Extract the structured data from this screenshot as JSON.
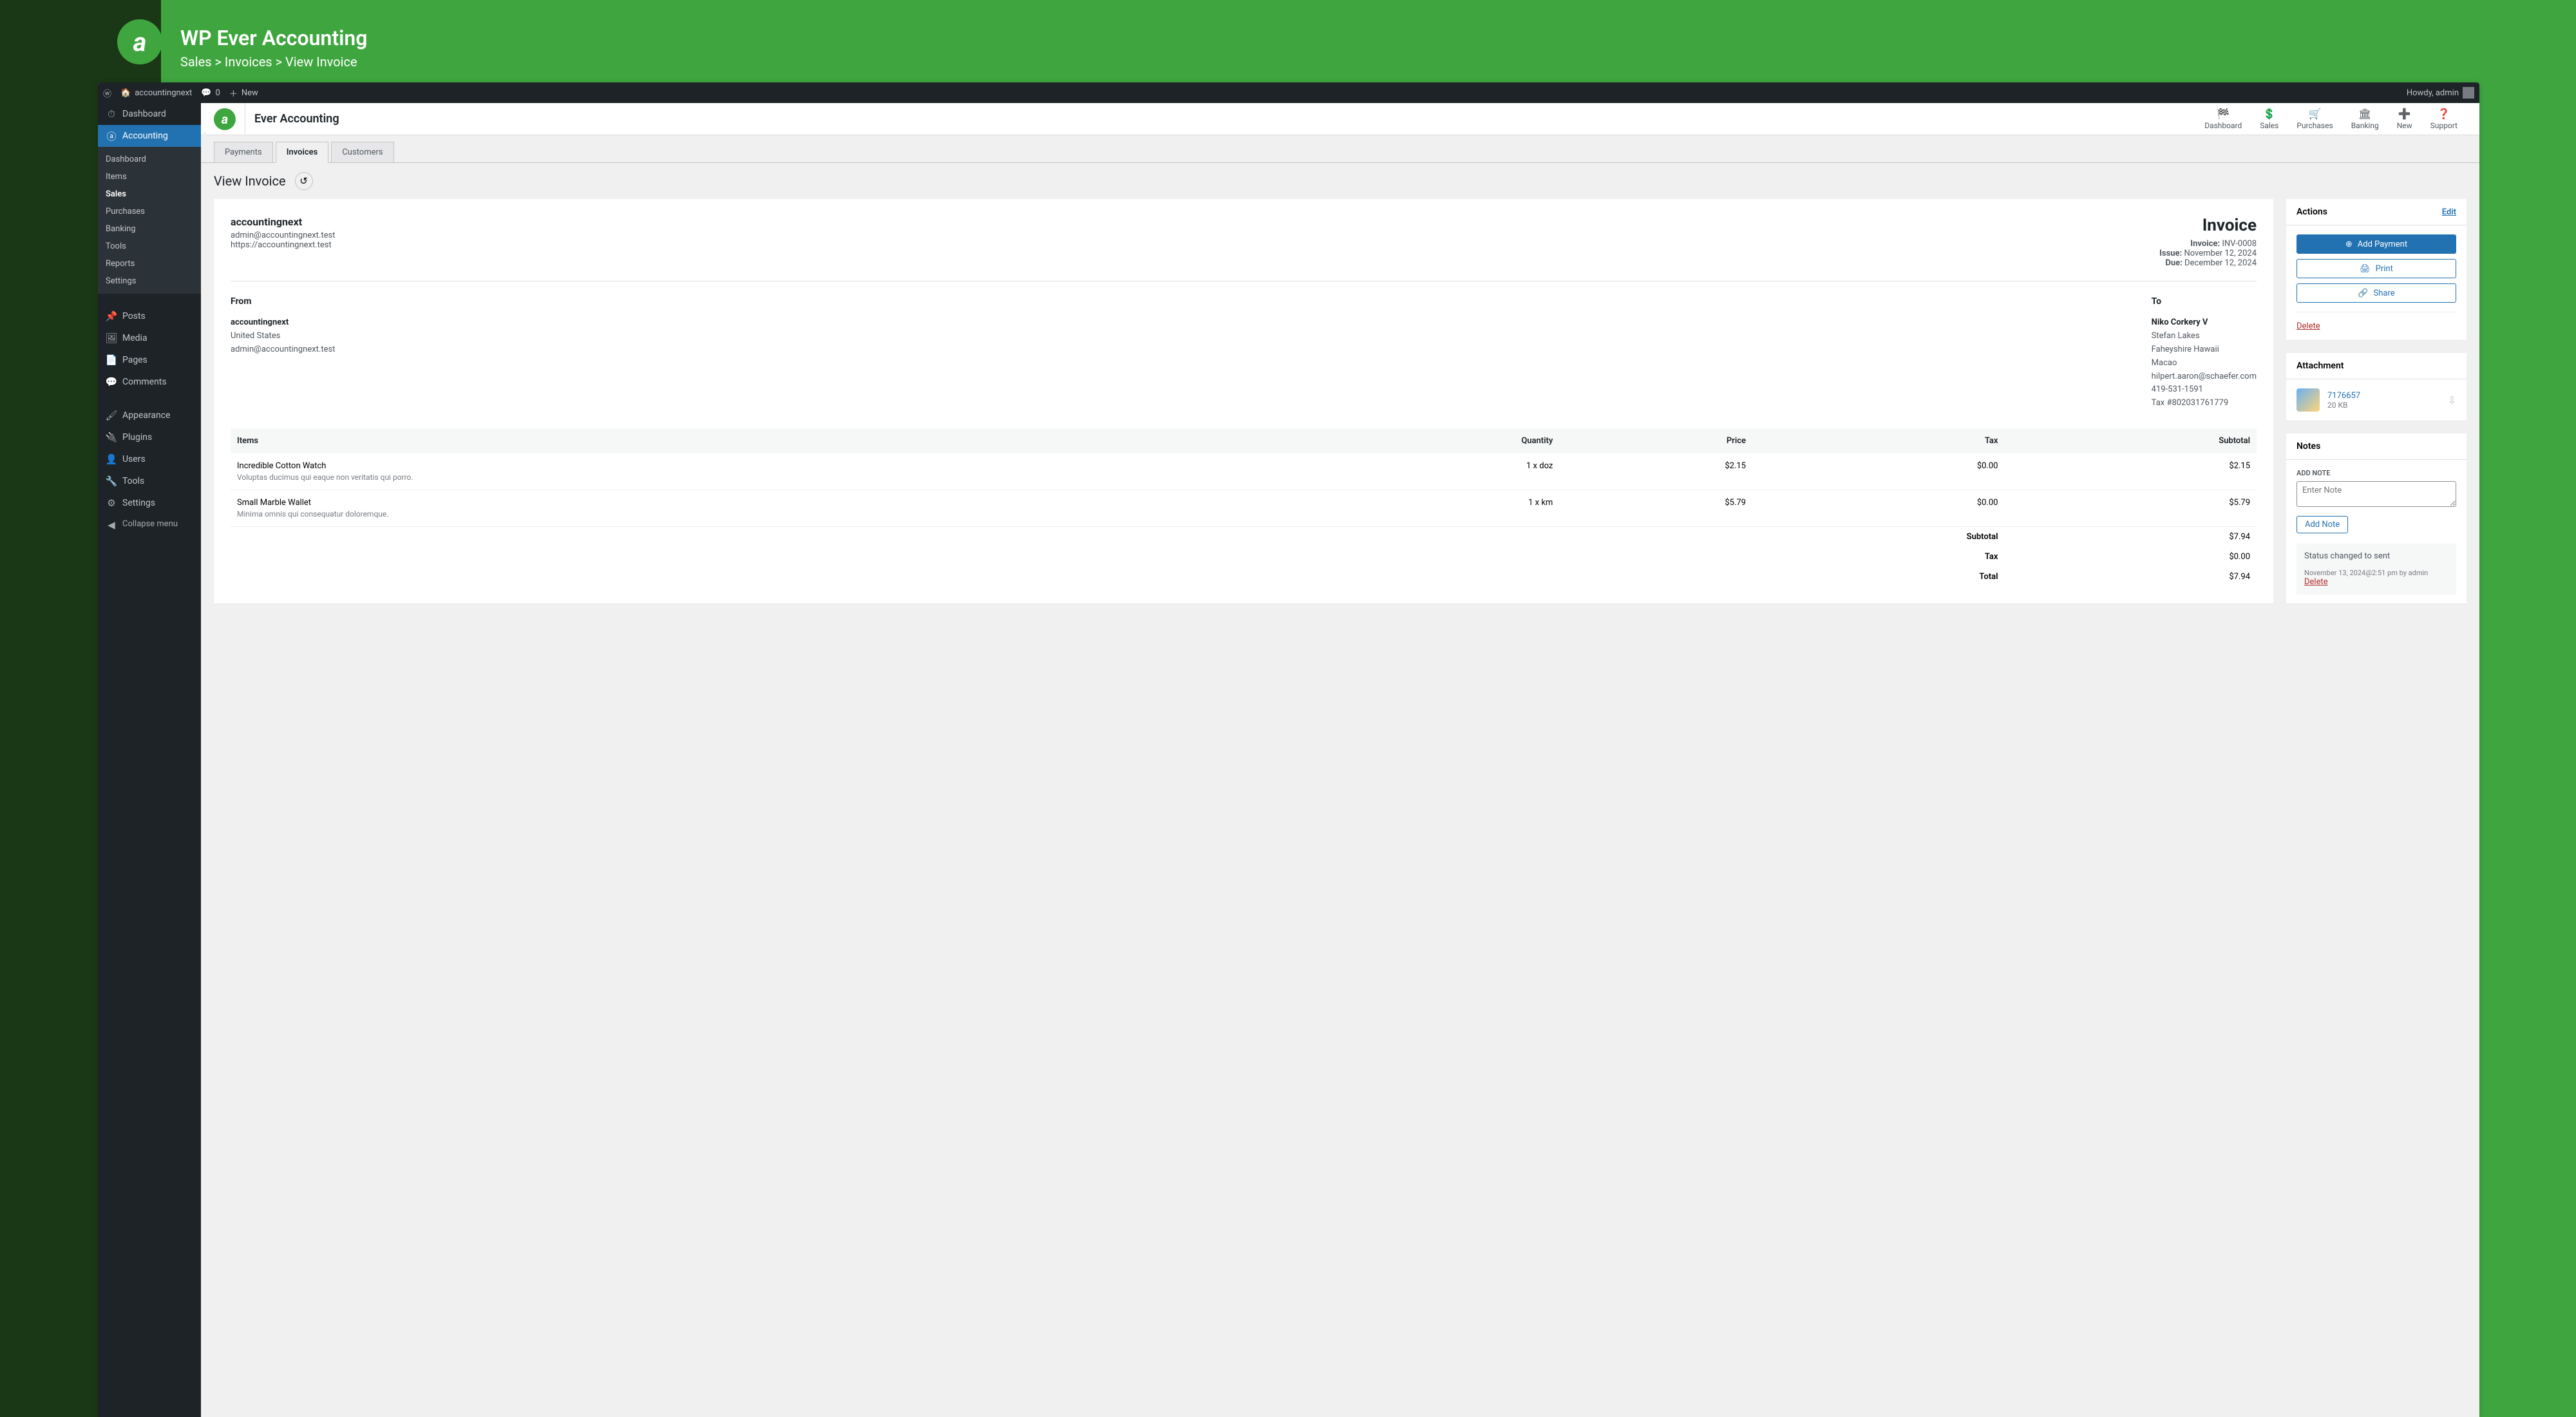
{
  "banner": {
    "title": "WP Ever Accounting",
    "breadcrumb": "Sales > Invoices > View Invoice"
  },
  "adminbar": {
    "site_name": "accountingnext",
    "comments": "0",
    "new": "New",
    "howdy": "Howdy, admin"
  },
  "sidebar": {
    "dashboard": "Dashboard",
    "accounting": "Accounting",
    "sub": {
      "dashboard": "Dashboard",
      "items": "Items",
      "sales": "Sales",
      "purchases": "Purchases",
      "banking": "Banking",
      "tools": "Tools",
      "reports": "Reports",
      "settings": "Settings"
    },
    "posts": "Posts",
    "media": "Media",
    "pages": "Pages",
    "comments": "Comments",
    "appearance": "Appearance",
    "plugins": "Plugins",
    "users": "Users",
    "tools": "Tools",
    "settings": "Settings",
    "collapse": "Collapse menu"
  },
  "ever_header": {
    "title": "Ever Accounting",
    "nav": {
      "dashboard": "Dashboard",
      "sales": "Sales",
      "purchases": "Purchases",
      "banking": "Banking",
      "new": "New",
      "support": "Support"
    }
  },
  "tabs": {
    "payments": "Payments",
    "invoices": "Invoices",
    "customers": "Customers"
  },
  "page_title": "View Invoice",
  "invoice": {
    "company_name": "accountingnext",
    "company_email": "admin@accountingnext.test",
    "company_url": "https://accountingnext.test",
    "heading": "Invoice",
    "number_label": "Invoice:",
    "number": "INV-0008",
    "issue_label": "Issue:",
    "issue": "November 12, 2024",
    "due_label": "Due:",
    "due": "December 12, 2024",
    "from_label": "From",
    "from": {
      "name": "accountingnext",
      "country": "United States",
      "email": "admin@accountingnext.test"
    },
    "to_label": "To",
    "to": {
      "name": "Niko Corkery V",
      "line1": "Stefan Lakes",
      "line2": "Faheyshire Hawaii",
      "country": "Macao",
      "email": "hilpert.aaron@schaefer.com",
      "phone": "419-531-1591",
      "tax": "Tax #802031761779"
    },
    "cols": {
      "items": "Items",
      "qty": "Quantity",
      "price": "Price",
      "tax": "Tax",
      "subtotal": "Subtotal"
    },
    "lines": [
      {
        "name": "Incredible Cotton Watch",
        "desc": "Voluptas ducimus qui eaque non veritatis qui porro.",
        "qty": "1 x doz",
        "price": "$2.15",
        "tax": "$0.00",
        "subtotal": "$2.15"
      },
      {
        "name": "Small Marble Wallet",
        "desc": "Minima omnis qui consequatur doloremque.",
        "qty": "1 x km",
        "price": "$5.79",
        "tax": "$0.00",
        "subtotal": "$5.79"
      }
    ],
    "totals": {
      "subtotal_label": "Subtotal",
      "subtotal": "$7.94",
      "tax_label": "Tax",
      "tax": "$0.00",
      "total_label": "Total",
      "total": "$7.94"
    }
  },
  "actions": {
    "title": "Actions",
    "edit": "Edit",
    "add_payment": "Add Payment",
    "print": "Print",
    "share": "Share",
    "delete": "Delete"
  },
  "attachment": {
    "title": "Attachment",
    "name": "7176657",
    "size": "20 KB"
  },
  "notes": {
    "title": "Notes",
    "add_label": "ADD NOTE",
    "placeholder": "Enter Note",
    "add_button": "Add Note",
    "entry_text": "Status changed to sent",
    "entry_meta": "November 13, 2024@2:51 pm by admin",
    "entry_delete": "Delete"
  }
}
